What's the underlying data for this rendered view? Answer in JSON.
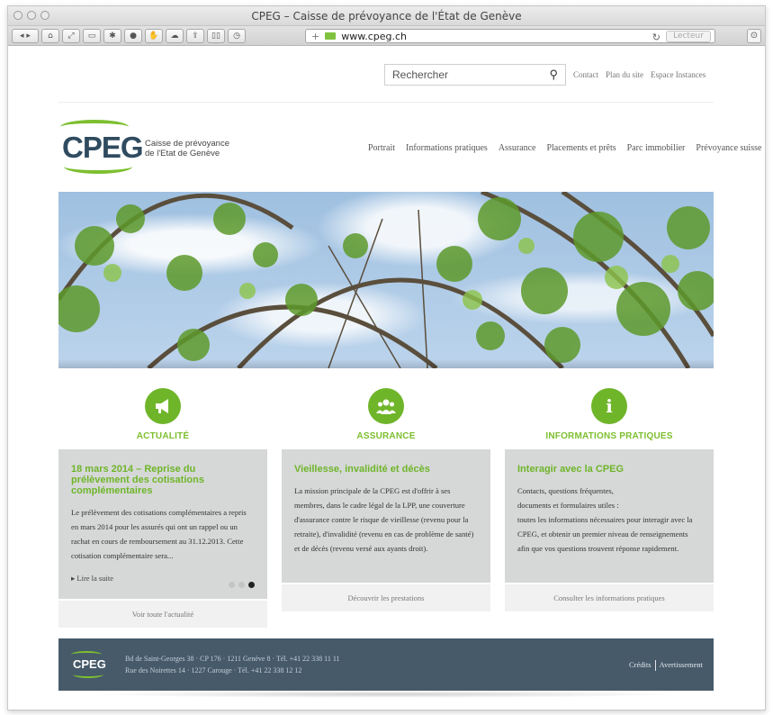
{
  "window": {
    "title": "CPEG – Caisse de prévoyance de l'État de Genève",
    "url": "www.cpeg.ch",
    "reader_label": "Lecteur"
  },
  "header": {
    "search_placeholder": "Rechercher",
    "top_links": [
      "Contact",
      "Plan du site",
      "Espace Instances"
    ],
    "logo_text": "CPEG",
    "logo_subtitle_line1": "Caisse de prévoyance",
    "logo_subtitle_line2": "de l'Etat de Genève",
    "nav": [
      "Portrait",
      "Informations pratiques",
      "Assurance",
      "Placements et prêts",
      "Parc immobilier",
      "Prévoyance suisse"
    ]
  },
  "columns": [
    {
      "icon": "megaphone-icon",
      "icon_glyph": "📢",
      "heading": "ACTUALITÉ",
      "title": "18 mars 2014 – Reprise du prélèvement des cotisations complémentaires",
      "body": "Le prélèvement des cotisations complémentaires a repris en mars 2014 pour les assurés qui ont un rappel ou un rachat en cours de remboursement au 31.12.2013. Cette cotisation complémentaire sera...",
      "more_link": "▸ Lire la suite",
      "footer_link": "Voir toute l'actualité"
    },
    {
      "icon": "people-icon",
      "icon_glyph": "👥",
      "heading": "ASSURANCE",
      "title": "Vieillesse, invalidité et décès",
      "body": "La mission principale de la CPEG est d'offrir à ses membres, dans le cadre légal de la LPP, une couverture d'assurance contre le risque de vieillesse (revenu pour la retraite), d'invalidité (revenu en cas de problème de santé) et de décès (revenu versé aux ayants droit).",
      "footer_link": "Découvrir les prestations"
    },
    {
      "icon": "info-icon",
      "icon_glyph": "i",
      "heading": "INFORMATIONS PRATIQUES",
      "title": "Interagir avec la CPEG",
      "body_line1": "Contacts, questions fréquentes,",
      "body_line2": "documents et formulaires utiles :",
      "body_line3": "toutes les informations nécessaires pour interagir avec la CPEG, et obtenir un premier niveau de renseignements afin que vos questions trouvent réponse rapidement.",
      "footer_link": "Consulter les informations pratiques"
    }
  ],
  "carousel": {
    "current_slide": 3,
    "total_slides": 3
  },
  "footer": {
    "logo_text": "CPEG",
    "address_line1": "Bd de Saint-Georges 38 · CP 176 · 1211 Genève 8 · Tél. +41 22 338 11 11",
    "address_line2": "Rue des Noirettes 14 · 1227 Carouge · Tél. +41 22 338 12 12",
    "links": [
      "Crédits",
      "Avertissement"
    ]
  },
  "colors": {
    "brand_green": "#6fb52a",
    "brand_navy": "#2f4b60",
    "footer_bg": "#465a6a",
    "card_bg": "#d6d8d7"
  }
}
